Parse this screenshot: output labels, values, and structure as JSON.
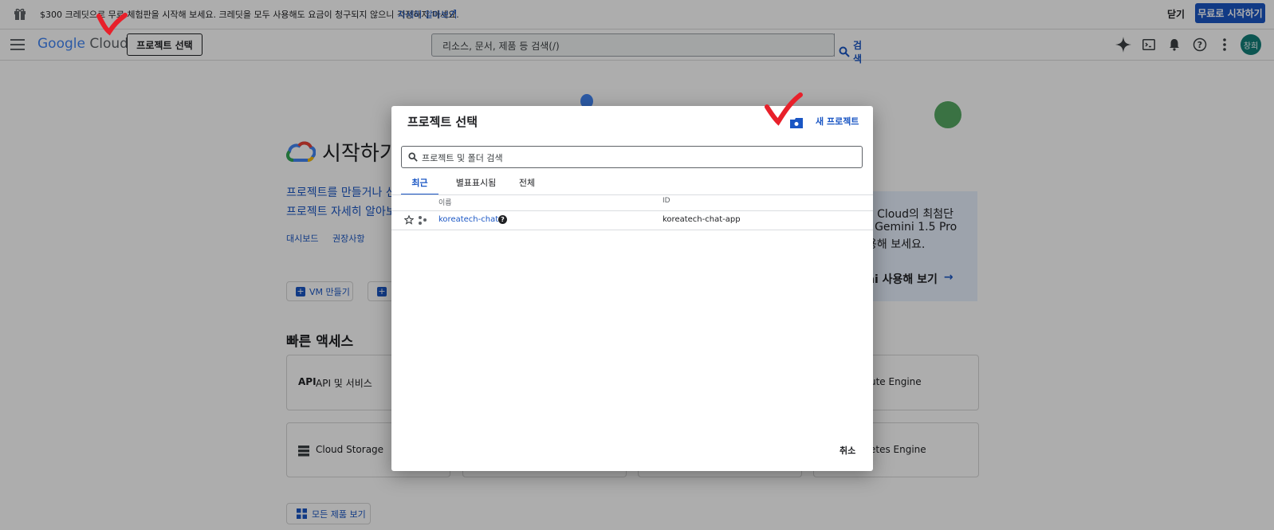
{
  "banner": {
    "text": "$300 크레딧으로 무료 체험판을 시작해 보세요. 크레딧을 모두 사용해도 요금이 청구되지 않으니 걱정하지 마세요.",
    "link": "자세히 알아보기",
    "close": "닫기",
    "cta": "무료로 시작하기"
  },
  "topbar": {
    "logo_google": "Google",
    "logo_cloud": "Cloud",
    "project_button": "프로젝트 선택",
    "search_placeholder": "리소스, 문서, 제품 등 검색(/)",
    "search_button": "검색",
    "avatar": "창희"
  },
  "page": {
    "title": "시작하기",
    "desc_line1": "프로젝트를 만들거나 선",
    "desc_line2": "프로젝트 자세히 알아보",
    "link_dashboard": "대시보드",
    "link_recommend": "권장사항",
    "vm_button": "VM 만들기",
    "quick_access_title": "빠른 액세스",
    "tile_api": "API 및 서비스",
    "tile_storage": "Cloud Storage",
    "tile_compute": "ute Engine",
    "tile_kube": "etes Engine",
    "all_products": "모든 제품 보기",
    "promo_line1": "e Cloud의 최첨단",
    "promo_line2": "! Gemini 1.5 Pro",
    "promo_line3": "용해 보세요.",
    "promo_link": "ni 사용해 보기"
  },
  "dialog": {
    "title": "프로젝트 선택",
    "new_project": "새 프로젝트",
    "search_placeholder": "프로젝트 및 폴더 검색",
    "tabs": [
      "최근",
      "별표표시됨",
      "전체"
    ],
    "columns": {
      "name": "이름",
      "id": "ID"
    },
    "rows": [
      {
        "name": "koreatech-chat",
        "id": "koreatech-chat-app"
      }
    ],
    "cancel": "취소"
  },
  "colors": {
    "accent": "#1a56c4",
    "cta_bg": "#1a56c4",
    "avatar_bg": "#137f7a",
    "check_mark": "#e8202a",
    "promo_bg": "#e8f0fe"
  }
}
